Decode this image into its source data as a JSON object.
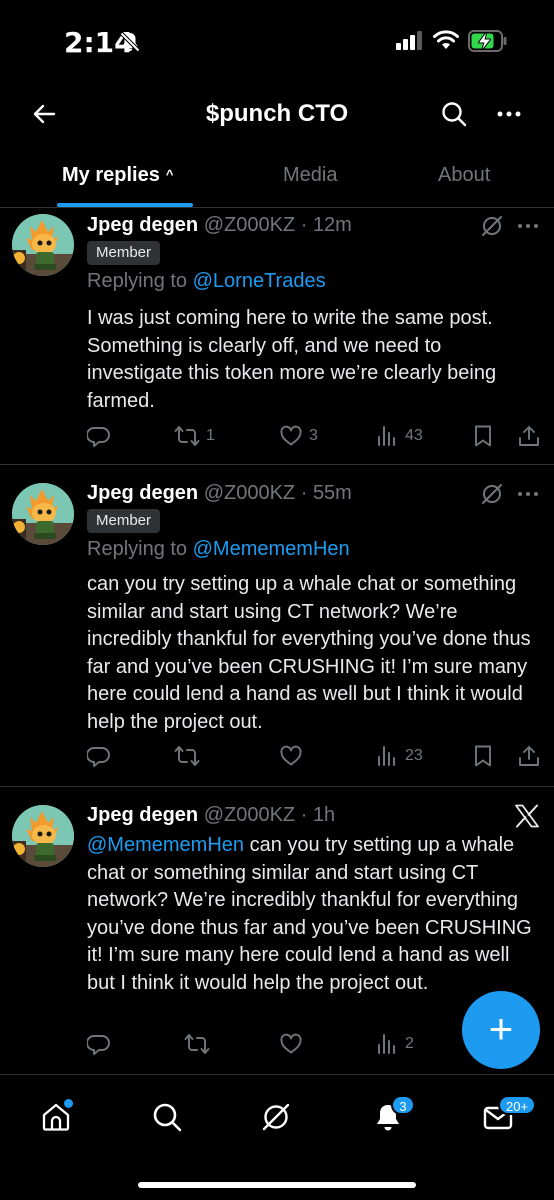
{
  "status_bar": {
    "time": "2:14"
  },
  "header": {
    "title": "$punch CTO"
  },
  "tabs": [
    {
      "label": "My replies",
      "active": true
    },
    {
      "label": "Media",
      "active": false
    },
    {
      "label": "About",
      "active": false
    }
  ],
  "posts": [
    {
      "name": "Jpeg degen",
      "handle": "@Z000KZ",
      "sep": " · ",
      "time": "12m",
      "badge": "Member",
      "replying_prefix": "Replying to ",
      "replying_to": "@LorneTrades",
      "text": "I was just coming here to write the same post. Something is clearly off, and we need to investigate this token more we’re clearly being farmed.",
      "reposts": "1",
      "likes": "3",
      "views": "43"
    },
    {
      "name": "Jpeg degen",
      "handle": "@Z000KZ",
      "sep": " · ",
      "time": "55m",
      "badge": "Member",
      "replying_prefix": "Replying to ",
      "replying_to": "@MemememHen",
      "text": "can you try setting up a whale chat or something similar and start using CT network? We’re incredibly thankful for everything you’ve done thus far and you’ve been CRUSHING it! I’m sure many here could lend a hand as well but I think it would help the project out.",
      "reposts": "",
      "likes": "",
      "views": "23"
    },
    {
      "name": "Jpeg degen",
      "handle": "@Z000KZ",
      "sep": " · ",
      "time": "1h",
      "mention": "@MemememHen",
      "text": " can you try setting up a whale chat or something similar and start using CT network? We’re incredibly thankful for everything you’ve done thus far and you’ve been CRUSHING it! I’m sure many here could lend a hand as well but I think it would help the project out.",
      "reposts": "",
      "likes": "",
      "views": "2"
    }
  ],
  "bottom_nav": {
    "notifications_count": "3",
    "messages_count": "20+"
  },
  "colors": {
    "accent": "#1d9bf0",
    "background": "#000000",
    "text": "#e7e9ea",
    "muted": "#71767b",
    "divider": "#2f3336"
  },
  "icons": [
    "back-arrow-icon",
    "search-icon",
    "more-icon",
    "grok-icon",
    "reply-icon",
    "repost-icon",
    "like-icon",
    "views-icon",
    "bookmark-icon",
    "share-icon",
    "x-logo-icon",
    "home-icon",
    "bell-icon",
    "mail-icon",
    "plus-icon"
  ]
}
